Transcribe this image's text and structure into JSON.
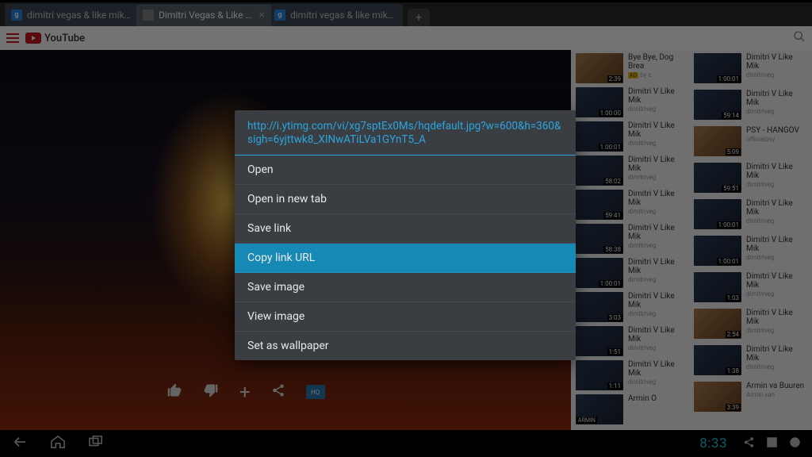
{
  "browser": {
    "tabs": [
      {
        "label": "dimitri vegas & like mike ...",
        "active": false
      },
      {
        "label": "Dimitri Vegas & Like Mik...",
        "active": true
      },
      {
        "label": "dimitri vegas & like mike ...",
        "active": false
      }
    ]
  },
  "youtube": {
    "brand": "YouTube"
  },
  "player_actions": {
    "hq": "HQ"
  },
  "context_menu": {
    "url": "http://i.ytimg.com/vi/xg7sptEx0Ms/hqdefault.jpg?w=600&h=360&sigh=6yjttwk8_XINwATiLVa1GYnT5_A",
    "items": [
      {
        "label": "Open",
        "selected": false
      },
      {
        "label": "Open in new tab",
        "selected": false
      },
      {
        "label": "Save link",
        "selected": false
      },
      {
        "label": "Copy link URL",
        "selected": true
      },
      {
        "label": "Save image",
        "selected": false
      },
      {
        "label": "View image",
        "selected": false
      },
      {
        "label": "Set as wallpaper",
        "selected": false
      }
    ]
  },
  "suggestions_left": [
    {
      "title": "Bye Bye, Dog Brea",
      "channel": "AD",
      "dur": "2:39",
      "warm": true,
      "ad": true
    },
    {
      "title": "Dimitri V\nLike Mik",
      "channel": "dimitriveg",
      "dur": "1:00:00"
    },
    {
      "title": "Dimitri V\nLike Mik",
      "channel": "dimitriveg",
      "dur": "1:00:01"
    },
    {
      "title": "Dimitri V\nLike Mik",
      "channel": "dimitriveg",
      "dur": "58:02"
    },
    {
      "title": "Dimitri V\nLike Mik",
      "channel": "dimitriveg",
      "dur": "59:41"
    },
    {
      "title": "Dimitri V\nLike Mik",
      "channel": "dimitriveg",
      "dur": "58:38"
    },
    {
      "title": "Dimitri V\nLike Mik",
      "channel": "dimitriveg",
      "dur": "1:00:01"
    },
    {
      "title": "Dimitri V\nLike Mik",
      "channel": "dimitriveg",
      "dur": "3:03"
    },
    {
      "title": "Dimitri V\nLike Mik",
      "channel": "dimitriveg",
      "dur": "1:51"
    },
    {
      "title": "Dimitri V\nLike Mik",
      "channel": "dimitriveg",
      "dur": "1:11"
    },
    {
      "title": "Armin O",
      "channel": "",
      "dur": "",
      "armin": true
    }
  ],
  "suggestions_right": [
    {
      "title": "Dimitri V\nLike Mik",
      "channel": "dimitriveg",
      "dur": "1:00:01"
    },
    {
      "title": "Dimitri V\nLike Mik",
      "channel": "dimitriveg",
      "dur": "59:14"
    },
    {
      "title": "PSY - \nHANGOV",
      "channel": "officialpsy",
      "dur": "5:09",
      "warm": true
    },
    {
      "title": "Dimitri V\nLike Mik",
      "channel": "dimitriveg",
      "dur": "59:51"
    },
    {
      "title": "Dimitri V\nLike Mik",
      "channel": "dimitriveg",
      "dur": "1:00:01"
    },
    {
      "title": "Dimitri V\nLike Mik",
      "channel": "dimitriveg",
      "dur": "1:00:01"
    },
    {
      "title": "Dimitri V\nLike Mik",
      "channel": "dimitriveg",
      "dur": "1:03"
    },
    {
      "title": "Dimitri V\nLike Mik",
      "channel": "dimitriveg",
      "dur": "2:54",
      "warm": true
    },
    {
      "title": "Dimitri V\nLike Mik",
      "channel": "dimitriveg",
      "dur": "1:38"
    },
    {
      "title": "Armin va\nBuuren",
      "channel": "Armin van",
      "dur": "3:39",
      "warm": true
    }
  ],
  "status_bar": {
    "clock": "8:33"
  }
}
